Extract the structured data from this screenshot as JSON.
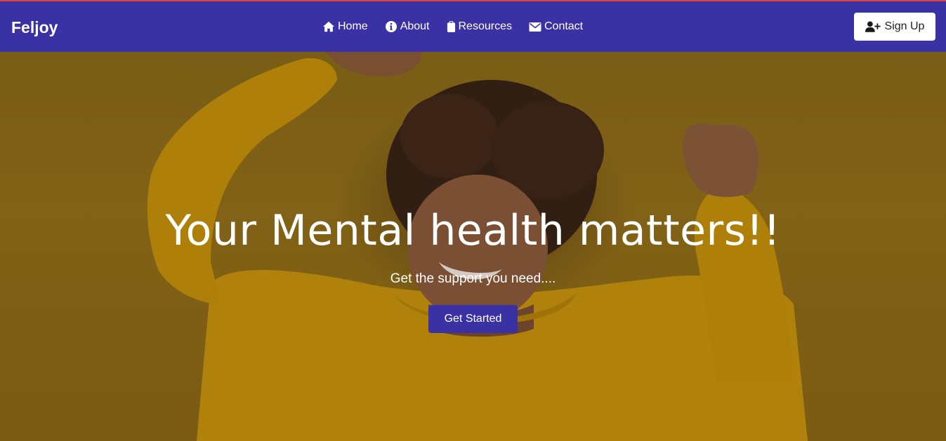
{
  "brand": {
    "name": "Feljoy"
  },
  "nav": {
    "items": [
      {
        "label": "Home",
        "icon": "home-icon"
      },
      {
        "label": "About",
        "icon": "info-circle-icon"
      },
      {
        "label": "Resources",
        "icon": "clipboard-icon"
      },
      {
        "label": "Contact",
        "icon": "envelope-icon"
      }
    ]
  },
  "signup": {
    "label": "Sign Up",
    "icon": "user-plus-icon"
  },
  "hero": {
    "title": "Your Mental health matters!!",
    "subtitle": "Get the support you need....",
    "cta_label": "Get Started",
    "image": "smiling-woman-yellow-sweater-arms-raised"
  },
  "colors": {
    "navbar": "#3a31a5",
    "accent_line": "#d9443a",
    "hero_background": "#9a7414",
    "cta": "#3a31a5"
  }
}
